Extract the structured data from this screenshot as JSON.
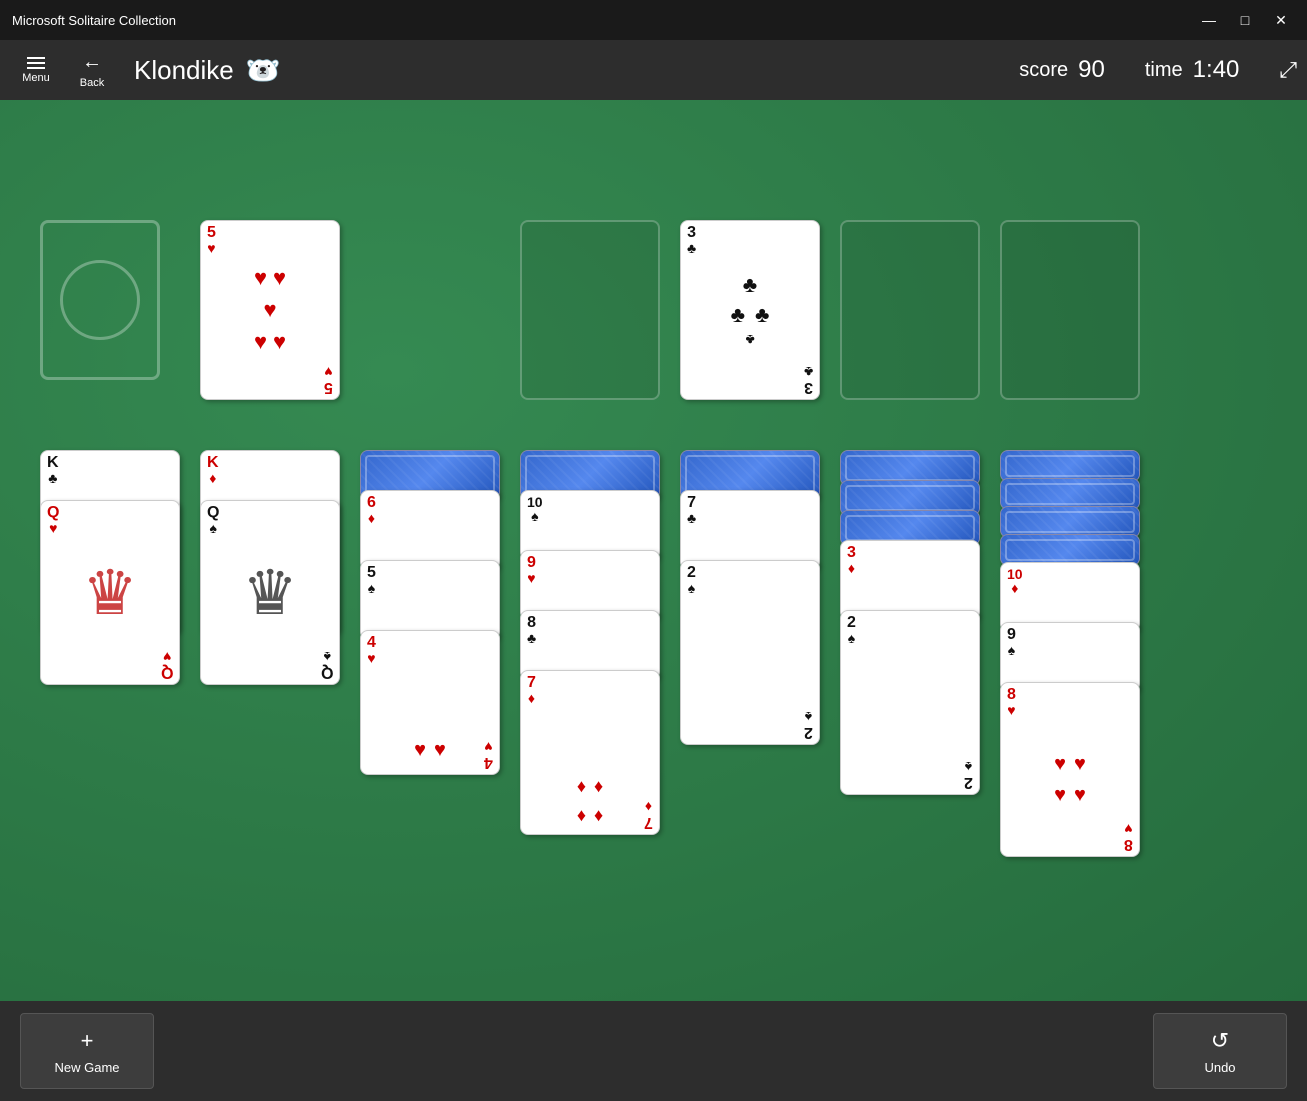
{
  "app": {
    "title": "Microsoft Solitaire Collection",
    "window_controls": {
      "minimize": "—",
      "maximize": "□",
      "close": "✕"
    }
  },
  "toolbar": {
    "menu_label": "Menu",
    "back_label": "Back",
    "game_title": "Klondike",
    "score_label": "score",
    "score_value": "90",
    "time_label": "time",
    "time_value": "1:40"
  },
  "bottom_bar": {
    "new_game_label": "New Game",
    "new_game_icon": "+",
    "undo_label": "Undo",
    "undo_icon": "↺"
  },
  "game": {
    "stock_pile": "empty",
    "waste_pile": {
      "rank": "5",
      "suit": "♥",
      "color": "red"
    },
    "foundations": [
      {
        "rank": "",
        "suit": ""
      },
      {
        "rank": "3",
        "suit": "♣",
        "color": "black"
      },
      {
        "rank": "",
        "suit": ""
      },
      {
        "rank": "",
        "suit": ""
      }
    ],
    "tableau": [
      {
        "col": 0,
        "cards": [
          {
            "rank": "K",
            "suit": "♣",
            "color": "black",
            "face": true
          },
          {
            "rank": "Q",
            "suit": "♥",
            "color": "red",
            "face": true
          }
        ]
      },
      {
        "col": 1,
        "cards": [
          {
            "rank": "K",
            "suit": "♦",
            "color": "red",
            "face": true
          },
          {
            "rank": "Q",
            "suit": "♠",
            "color": "black",
            "face": true
          }
        ]
      },
      {
        "col": 2,
        "cards": [
          {
            "back": true
          },
          {
            "rank": "6",
            "suit": "♦",
            "color": "red",
            "face": true
          },
          {
            "rank": "5",
            "suit": "♠",
            "color": "black",
            "face": true
          },
          {
            "rank": "4",
            "suit": "♥",
            "color": "red",
            "face": true
          }
        ]
      },
      {
        "col": 3,
        "cards": [
          {
            "back": true
          },
          {
            "rank": "10",
            "suit": "♠",
            "color": "black",
            "face": true
          },
          {
            "rank": "9",
            "suit": "♥",
            "color": "red",
            "face": true
          },
          {
            "rank": "8",
            "suit": "♣",
            "color": "black",
            "face": true
          },
          {
            "rank": "7",
            "suit": "♦",
            "color": "red",
            "face": true
          }
        ]
      },
      {
        "col": 4,
        "cards": [
          {
            "back": true
          },
          {
            "rank": "7",
            "suit": "♣",
            "color": "black",
            "face": true
          },
          {
            "rank": "2",
            "suit": "♠",
            "color": "black",
            "face": true
          }
        ]
      },
      {
        "col": 5,
        "cards": [
          {
            "back": true
          },
          {
            "back": true
          },
          {
            "back": true
          },
          {
            "rank": "3",
            "suit": "♦",
            "color": "red",
            "face": true
          },
          {
            "rank": "2",
            "suit": "♠",
            "color": "black",
            "face": true
          }
        ]
      },
      {
        "col": 6,
        "cards": [
          {
            "back": true
          },
          {
            "back": true
          },
          {
            "back": true
          },
          {
            "back": true
          },
          {
            "rank": "10",
            "suit": "♦",
            "color": "red",
            "face": true
          },
          {
            "rank": "9",
            "suit": "♠",
            "color": "black",
            "face": true
          },
          {
            "rank": "8",
            "suit": "♥",
            "color": "red",
            "face": true
          }
        ]
      }
    ]
  }
}
